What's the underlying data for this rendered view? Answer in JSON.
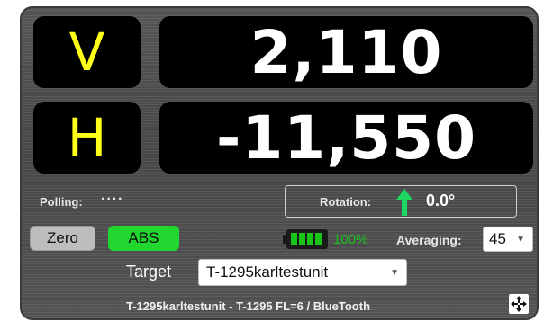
{
  "readouts": {
    "v": {
      "label": "V",
      "value": "2,110"
    },
    "h": {
      "label": "H",
      "value": "-11,550"
    }
  },
  "polling": {
    "label": "Polling:",
    "indicator": "····"
  },
  "rotation": {
    "label": "Rotation:",
    "value": "0.0°",
    "arrow_color": "#1ed760"
  },
  "buttons": {
    "zero": "Zero",
    "abs": "ABS"
  },
  "battery": {
    "percent_text": "100%",
    "level": 1.0,
    "color": "#19c419"
  },
  "averaging": {
    "label": "Averaging:",
    "value": "45"
  },
  "target": {
    "label": "Target",
    "value": "T-1295karltestunit"
  },
  "status": {
    "text": "T-1295karltestunit - T-1295 FL=6 / BlueTooth"
  },
  "icons": {
    "fullscreen": "expand-arrows-icon"
  },
  "colors": {
    "axis_label": "#ffff18",
    "abs_active": "#22d630"
  }
}
